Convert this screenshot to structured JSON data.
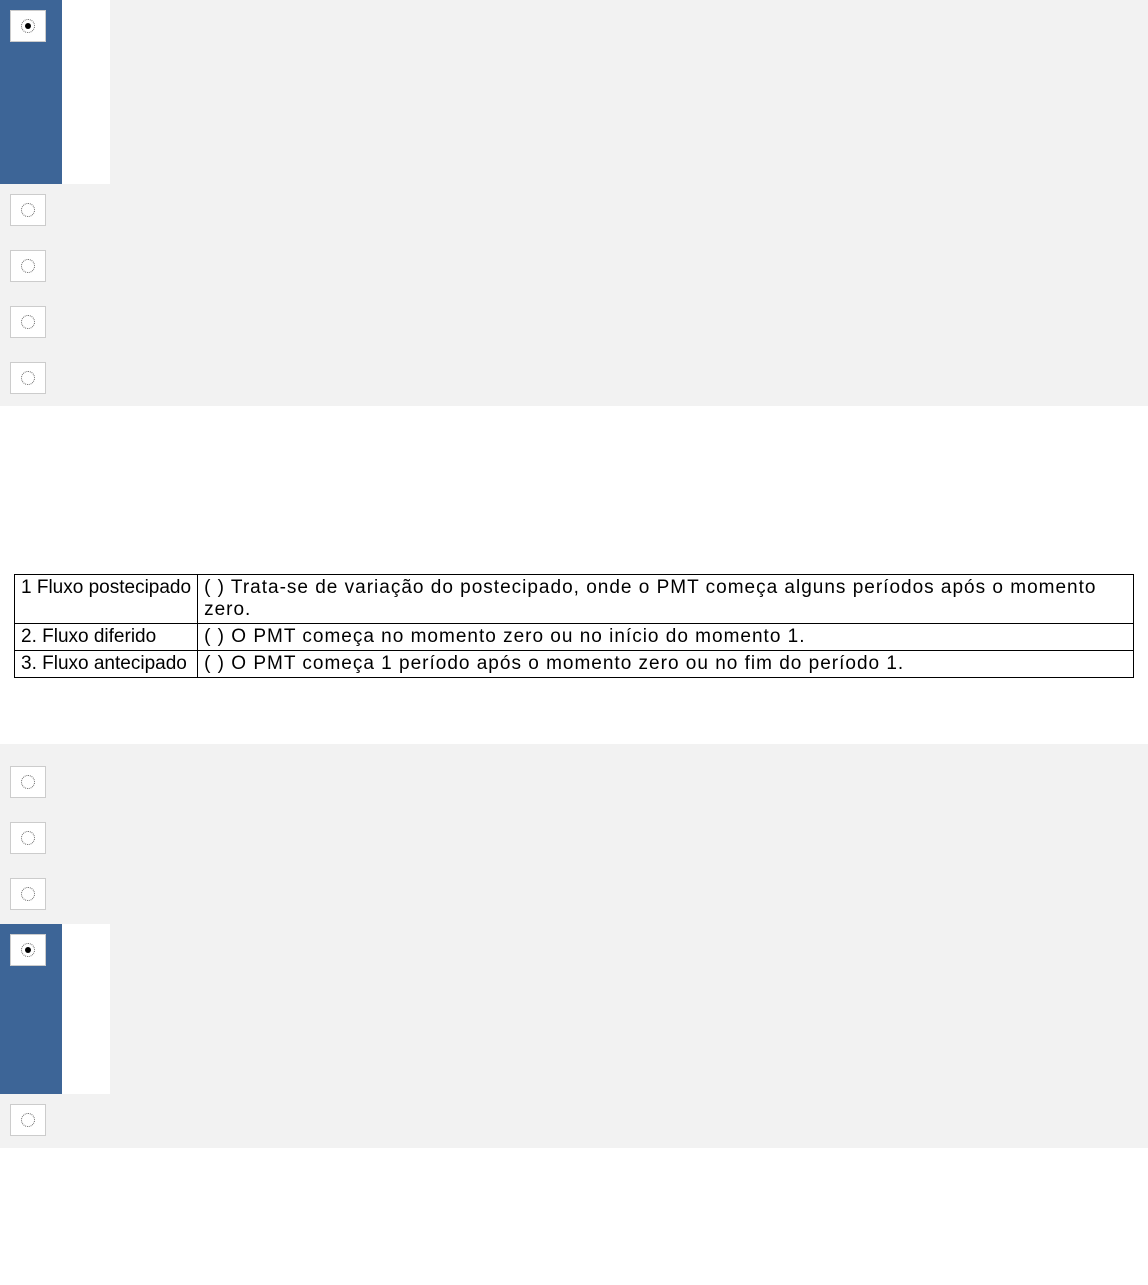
{
  "q1": {
    "selected_index": 0,
    "options": [
      "",
      "",
      "",
      "",
      ""
    ]
  },
  "match_table": {
    "rows": [
      {
        "left": "1 Fluxo postecipado",
        "right": "(    ) Trata-se de variação do postecipado, onde o PMT começa alguns períodos após o momento zero."
      },
      {
        "left": "2. Fluxo diferido",
        "right": "(    ) O PMT começa no momento zero ou no início do momento 1."
      },
      {
        "left": "3. Fluxo antecipado",
        "right": "(    ) O PMT começa 1 período após o momento zero ou no fim do período 1."
      }
    ]
  },
  "q2": {
    "selected_index": 3,
    "options": [
      "",
      "",
      "",
      "",
      ""
    ]
  }
}
